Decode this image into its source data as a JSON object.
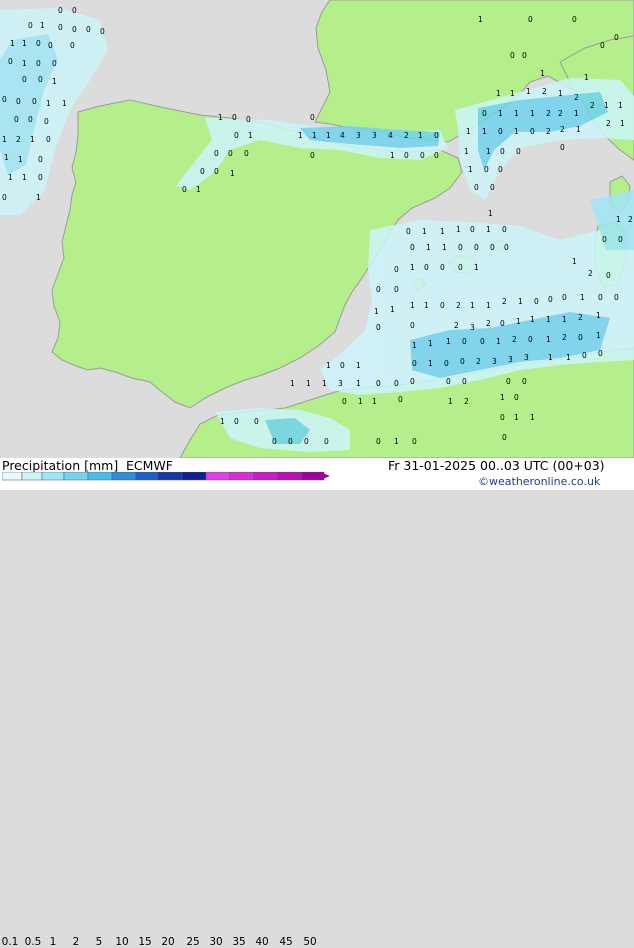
{
  "map": {
    "sea_color": "#dcdcdc",
    "land_color": "#b5ef8c",
    "coast_color": "#999999",
    "precip_colors": [
      "#cdf5fb",
      "#9fe6f5",
      "#72d3ee",
      "#4cbde6"
    ],
    "rain_figures": [
      "0",
      "0",
      "0",
      "1",
      "0",
      "0",
      "0",
      "0",
      "1",
      "1",
      "0",
      "0",
      "0",
      "0",
      "1",
      "0",
      "0",
      "0",
      "0",
      "1",
      "0",
      "0",
      "0",
      "1",
      "1",
      "0",
      "0",
      "0",
      "1",
      "2",
      "1",
      "0",
      "1",
      "1",
      "0",
      "1",
      "1",
      "0",
      "0",
      "1",
      "1",
      "0",
      "0",
      "0",
      "0",
      "1",
      "1",
      "1",
      "1",
      "4",
      "3",
      "3",
      "4",
      "2",
      "1",
      "0",
      "0",
      "0",
      "0",
      "0",
      "1",
      "0",
      "0",
      "0",
      "0",
      "0",
      "1",
      "0",
      "1",
      "1",
      "0",
      "0",
      "0",
      "0",
      "0",
      "0",
      "1",
      "1",
      "1",
      "1",
      "1",
      "2",
      "1",
      "2",
      "2",
      "1",
      "1",
      "0",
      "1",
      "1",
      "1",
      "2",
      "2",
      "1",
      "2",
      "1",
      "1",
      "0",
      "1",
      "0",
      "2",
      "2",
      "1",
      "1",
      "1",
      "1",
      "0",
      "0",
      "0",
      "1",
      "0",
      "0",
      "0",
      "0",
      "1",
      "0",
      "1",
      "1",
      "1",
      "0",
      "1",
      "0",
      "1",
      "2",
      "0",
      "1",
      "1",
      "0",
      "0",
      "0",
      "0",
      "0",
      "0",
      "0",
      "1",
      "0",
      "0",
      "0",
      "1",
      "1",
      "2",
      "0",
      "0",
      "0",
      "1",
      "1",
      "0",
      "2",
      "1",
      "1",
      "2",
      "1",
      "0",
      "0",
      "0",
      "1",
      "0",
      "0",
      "1",
      "1",
      "0",
      "0",
      "2",
      "3",
      "2",
      "0",
      "1",
      "1",
      "1",
      "1",
      "2",
      "1",
      "1",
      "1",
      "1",
      "0",
      "0",
      "1",
      "2",
      "0",
      "1",
      "2",
      "0",
      "1",
      "0",
      "1",
      "0",
      "0",
      "2",
      "3",
      "3",
      "3",
      "1",
      "1",
      "0",
      "0",
      "1",
      "0",
      "1",
      "1",
      "1",
      "1",
      "3",
      "1",
      "0",
      "0",
      "0",
      "0",
      "0",
      "0",
      "0",
      "0",
      "1",
      "1",
      "0",
      "1",
      "2",
      "1",
      "0",
      "1",
      "0",
      "0",
      "0",
      "1",
      "1",
      "0",
      "0",
      "0",
      "0",
      "0",
      "1",
      "0",
      "0",
      "0",
      "0",
      "0",
      "1",
      "3",
      "3",
      "0",
      "2",
      "3",
      "0",
      "0",
      "1",
      "0",
      "0",
      "0"
    ]
  },
  "footer": {
    "title": "Precipitation [mm]",
    "model": "ECMWF",
    "datetime": "Fr 31-01-2025 00..03 UTC (00+03)",
    "credit": "©weatheronline.co.uk",
    "legend": {
      "labels": [
        "0.1",
        "0.5",
        "1",
        "2",
        "5",
        "10",
        "15",
        "20",
        "25",
        "30",
        "35",
        "40",
        "45",
        "50"
      ],
      "colors": [
        "#e8fafd",
        "#cdf5fb",
        "#9fe6f5",
        "#72d3ee",
        "#4cbde6",
        "#2a8ed8",
        "#1f5fc8",
        "#1838a8",
        "#102090",
        "#e040e8",
        "#d82ed8",
        "#c81ec8",
        "#b810b8",
        "#a000a0"
      ]
    }
  }
}
